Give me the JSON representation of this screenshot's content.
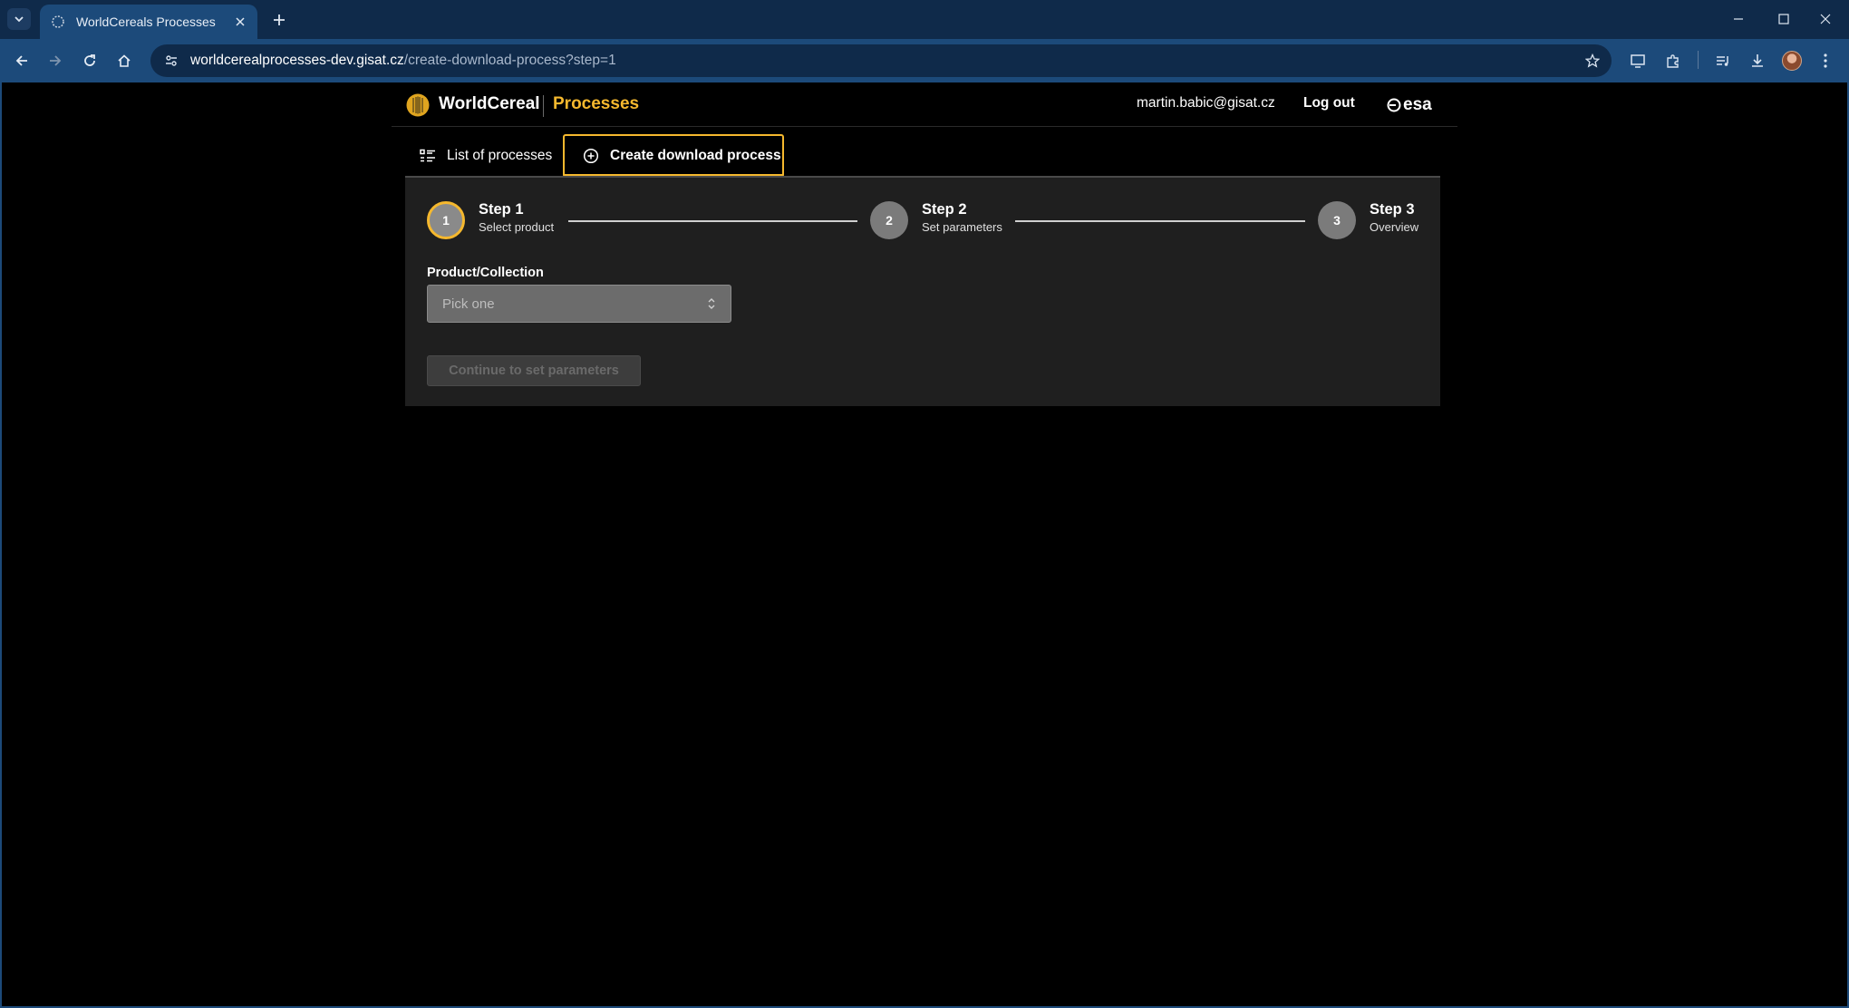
{
  "browser": {
    "tab_title": "WorldCereals Processes",
    "url_host": "worldcerealprocesses-dev.gisat.cz",
    "url_path": "/create-download-process?step=1"
  },
  "header": {
    "brand": "WorldCereal",
    "section": "Processes",
    "user_email": "martin.babic@gisat.cz",
    "logout_label": "Log out",
    "partner_logo_text": "esa"
  },
  "tabs": [
    {
      "label": "List of processes",
      "icon": "list-icon",
      "active": false
    },
    {
      "label": "Create download process",
      "icon": "plus-circle-icon",
      "active": true
    }
  ],
  "stepper": {
    "steps": [
      {
        "number": "1",
        "title": "Step 1",
        "subtitle": "Select product",
        "active": true
      },
      {
        "number": "2",
        "title": "Step 2",
        "subtitle": "Set parameters",
        "active": false
      },
      {
        "number": "3",
        "title": "Step 3",
        "subtitle": "Overview",
        "active": false
      }
    ]
  },
  "form": {
    "product_label": "Product/Collection",
    "product_placeholder": "Pick one",
    "continue_label": "Continue to set parameters",
    "continue_disabled": true
  },
  "colors": {
    "accent": "#f5b82e",
    "panel_bg": "#1f1f1f",
    "page_bg": "#000000",
    "chrome_bg": "#1c4a7a"
  }
}
